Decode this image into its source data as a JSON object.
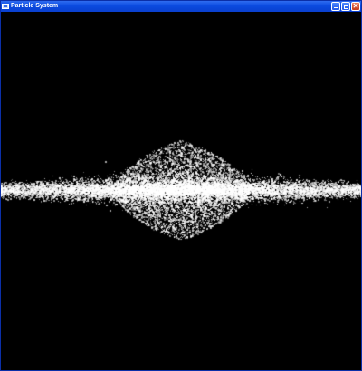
{
  "window": {
    "title": "Particle System",
    "icon": "app-window-icon",
    "buttons": {
      "minimize_icon": "minimize-icon",
      "maximize_icon": "maximize-icon",
      "close_icon": "close-icon",
      "close_glyph": "✕"
    }
  },
  "colors": {
    "titlebar": "#0b4be0",
    "client_background": "#000000",
    "particle": "#ffffff",
    "close_button": "#c6391a"
  }
}
